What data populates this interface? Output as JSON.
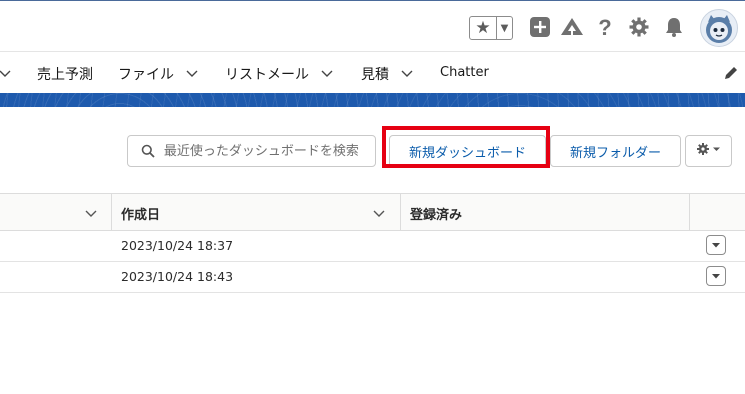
{
  "global_header": {
    "favorites_icon": "star-icon",
    "favorites_menu_icon": "caret-down-icon",
    "icons": [
      "plus-box-icon",
      "trailhead-icon",
      "help-icon",
      "setup-gear-icon",
      "notification-bell-icon",
      "user-avatar-icon"
    ]
  },
  "nav": {
    "items": [
      {
        "label": "売上予測"
      },
      {
        "label": "ファイル"
      },
      {
        "label": "リストメール"
      },
      {
        "label": "見積"
      },
      {
        "label": "Chatter"
      }
    ],
    "edit_icon": "pencil-icon"
  },
  "toolbar": {
    "search_placeholder": "最近使ったダッシュボードを検索",
    "new_dashboard_label": "新規ダッシュボード",
    "new_folder_label": "新規フォルダー",
    "settings_icon": "gear-icon"
  },
  "table": {
    "columns": [
      {
        "label": ""
      },
      {
        "label": "作成日"
      },
      {
        "label": "登録済み"
      }
    ],
    "rows": [
      {
        "created": "2023/10/24 18:37",
        "subscribed": ""
      },
      {
        "created": "2023/10/24 18:43",
        "subscribed": ""
      }
    ]
  },
  "colors": {
    "brand_band": "#1e5aad",
    "link_blue": "#0b5cab",
    "highlight_red": "#e60012"
  }
}
